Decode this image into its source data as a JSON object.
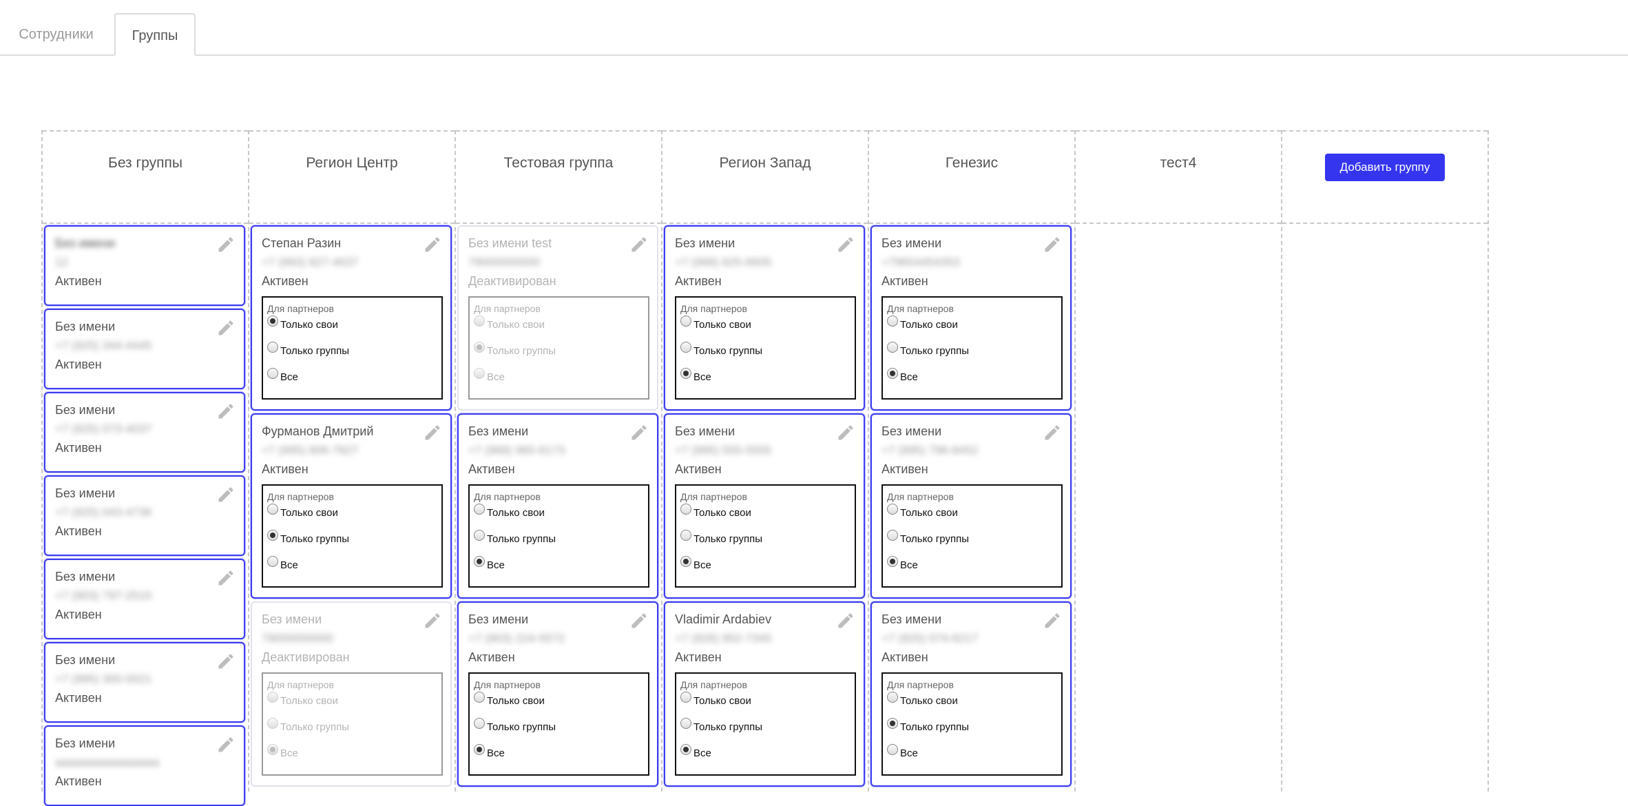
{
  "tabs": {
    "employees": "Сотрудники",
    "groups": "Группы"
  },
  "add_group_label": "Добавить группу",
  "perm_title": "Для партнеров",
  "perm_options": [
    "Только свои",
    "Только группы",
    "Все"
  ],
  "colors": {
    "accent": "#3535f0",
    "card_border": "#3d3df0"
  },
  "columns": [
    {
      "title": "Без группы",
      "cards": [
        {
          "name": "Без имени",
          "phone": "12",
          "status": "Активен",
          "active": true,
          "perms": false,
          "blur_name": true
        },
        {
          "name": "Без имени",
          "phone": "+7 (925) 344-4445",
          "status": "Активен",
          "active": true,
          "perms": false
        },
        {
          "name": "Без имени",
          "phone": "+7 (925) 073-4037",
          "status": "Активен",
          "active": true,
          "perms": false
        },
        {
          "name": "Без имени",
          "phone": "+7 (925) 043-4736",
          "status": "Активен",
          "active": true,
          "perms": false
        },
        {
          "name": "Без имени",
          "phone": "+7 (903) 797-2515",
          "status": "Активен",
          "active": true,
          "perms": false
        },
        {
          "name": "Без имени",
          "phone": "+7 (995) 300-0021",
          "status": "Активен",
          "active": true,
          "perms": false
        },
        {
          "name": "Без имени",
          "phone": "aaaaaaaaaaaaaaaa",
          "status": "Активен",
          "active": true,
          "perms": false
        }
      ]
    },
    {
      "title": "Регион Центр",
      "cards": [
        {
          "name": "Степан Разин",
          "phone": "+7 (993) 827-4637",
          "status": "Активен",
          "active": true,
          "perms": true,
          "selected": 0
        },
        {
          "name": "Фурманов Дмитрий",
          "phone": "+7 (995) 806-7827",
          "status": "Активен",
          "active": true,
          "perms": true,
          "selected": 1
        },
        {
          "name": "Без имени",
          "phone": "79000000000",
          "status": "Деактивирован",
          "active": false,
          "perms": true,
          "selected": 2
        }
      ]
    },
    {
      "title": "Тестовая группа",
      "cards": [
        {
          "name": "Без имени test",
          "phone": "79000000000",
          "status": "Деактивирован",
          "active": false,
          "perms": true,
          "selected": 1
        },
        {
          "name": "Без имени",
          "phone": "+7 (968) 965-8173",
          "status": "Активен",
          "active": true,
          "perms": true,
          "selected": 2
        },
        {
          "name": "Без имени",
          "phone": "+7 (903) 224-5572",
          "status": "Активен",
          "active": true,
          "perms": true,
          "selected": 2
        }
      ]
    },
    {
      "title": "Регион Запад",
      "cards": [
        {
          "name": "Без имени",
          "phone": "+7 (999) 825-6605",
          "status": "Активен",
          "active": true,
          "perms": true,
          "selected": 2
        },
        {
          "name": "Без имени",
          "phone": "+7 (995) 555-5555",
          "status": "Активен",
          "active": true,
          "perms": true,
          "selected": 2
        },
        {
          "name": "Vladimir Ardabiev",
          "phone": "+7 (926) 952-7345",
          "status": "Активен",
          "active": true,
          "perms": true,
          "selected": 2
        }
      ]
    },
    {
      "title": "Генезис",
      "cards": [
        {
          "name": "Без имени",
          "phone": "+79654454353",
          "status": "Активен",
          "active": true,
          "perms": true,
          "selected": 2
        },
        {
          "name": "Без имени",
          "phone": "+7 (995) 796-8452",
          "status": "Активен",
          "active": true,
          "perms": true,
          "selected": 2
        },
        {
          "name": "Без имени",
          "phone": "+7 (925) 074-6217",
          "status": "Активен",
          "active": true,
          "perms": true,
          "selected": 1
        }
      ]
    },
    {
      "title": "тест4",
      "cards": []
    }
  ]
}
